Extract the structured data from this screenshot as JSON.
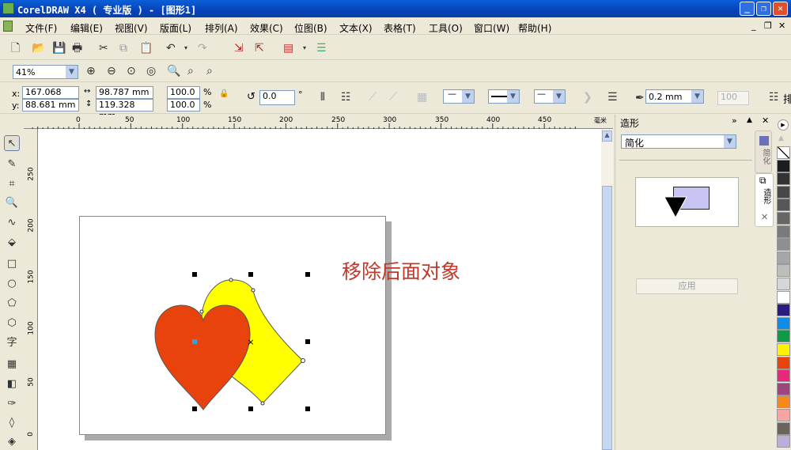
{
  "window": {
    "title": "CorelDRAW X4 ( 专业版 ) - [图形1]",
    "minimize": "_",
    "restore": "❐",
    "close": "✕"
  },
  "menu": [
    "文件(F)",
    "编辑(E)",
    "视图(V)",
    "版面(L)",
    "排列(A)",
    "效果(C)",
    "位图(B)",
    "文本(X)",
    "表格(T)",
    "工具(O)",
    "窗口(W)",
    "帮助(H)"
  ],
  "zoom": {
    "value": "41%"
  },
  "properties": {
    "x_label": "x:",
    "x": "167.068 mm",
    "y_label": "y:",
    "y": "88.681 mm",
    "width": "98.787 mm",
    "height": "119.328 mm",
    "scale_x": "100.0",
    "scale_y": "100.0",
    "pct": "%",
    "rotation": "0.0",
    "degree": "°",
    "outline_width": "0.2 mm",
    "disabled_value": "100",
    "cut_label": "排"
  },
  "ruler": {
    "top": [
      "0",
      "50",
      "100",
      "150",
      "200",
      "250",
      "300",
      "350",
      "400",
      "450"
    ],
    "unit": "毫米",
    "left": [
      "250",
      "200",
      "150",
      "100",
      "50",
      "0"
    ]
  },
  "canvas": {
    "annotation": "移除后面对象",
    "annotation_color": "#c0392b",
    "heart_color": "#e8430c",
    "shape_color": "#ffff00"
  },
  "docker": {
    "title": "造形",
    "mode": "简化",
    "apply": "应用",
    "tabs": [
      "简化",
      "造形"
    ],
    "close": "✕"
  },
  "palette": [
    "none",
    "#1c1c1c",
    "#333333",
    "#474747",
    "#575757",
    "#666666",
    "#7a7a7a",
    "#8f8f8f",
    "#a6a6a6",
    "#bdbdbd",
    "#d6d6d6",
    "#ffffff",
    "#2d1a80",
    "#0e8ce6",
    "#0f9a4a",
    "#fff200",
    "#e8430c",
    "#e8287a",
    "#a0457c",
    "#f7891c",
    "#f9a3a3",
    "#6b645a",
    "#b8b0d8"
  ],
  "accent": "#0a5fd8"
}
